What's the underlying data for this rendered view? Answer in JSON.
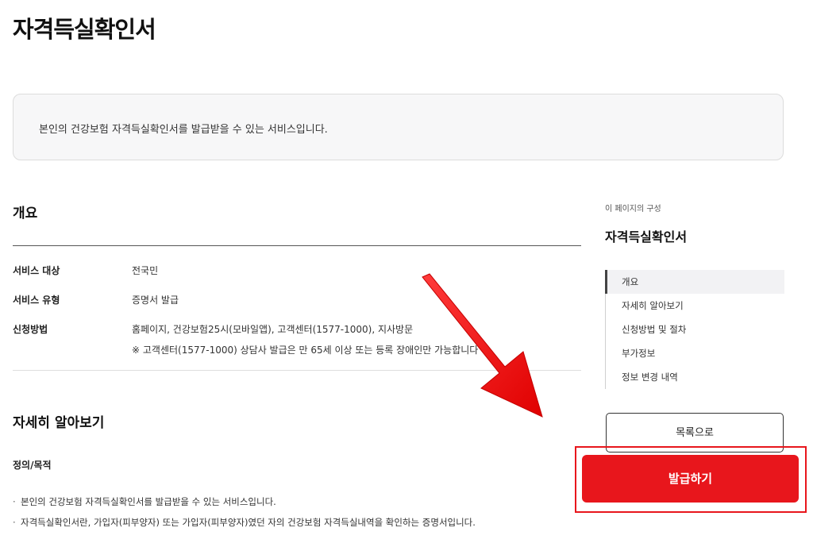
{
  "page": {
    "title": "자격득실확인서"
  },
  "intro": {
    "text": "본인의 건강보험 자격득실확인서를 발급받을 수 있는 서비스입니다."
  },
  "overview": {
    "title": "개요",
    "rows": [
      {
        "label": "서비스 대상",
        "value": "전국민"
      },
      {
        "label": "서비스 유형",
        "value": "증명서 발급"
      },
      {
        "label": "신청방법",
        "value": "홈페이지, 건강보험25시(모바일앱), 고객센터(1577-1000), 지사방문"
      }
    ],
    "note": "※  고객센터(1577-1000) 상담사 발급은 만 65세 이상 또는 등록 장애인만 가능합니다"
  },
  "detail": {
    "title": "자세히 알아보기",
    "subtitle": "정의/목적",
    "bullets": [
      "본인의 건강보험 자격득실확인서를 발급받을 수 있는 서비스입니다.",
      "자격득실확인서란, 가입자(피부양자) 또는 가입자(피부양자)였던 자의 건강보험 자격득실내역을 확인하는 증명서입니다."
    ]
  },
  "toc": {
    "caption": "이 페이지의 구성",
    "title": "자격득실확인서",
    "items": [
      {
        "label": "개요",
        "active": true
      },
      {
        "label": "자세히 알아보기",
        "active": false
      },
      {
        "label": "신청방법 및 절차",
        "active": false
      },
      {
        "label": "부가정보",
        "active": false
      },
      {
        "label": "정보 변경 내역",
        "active": false
      }
    ]
  },
  "buttons": {
    "list": "목록으로",
    "issue": "발급하기"
  },
  "colors": {
    "accent": "#e8161c",
    "intro_bg": "#f7f7f8",
    "text": "#222222"
  }
}
